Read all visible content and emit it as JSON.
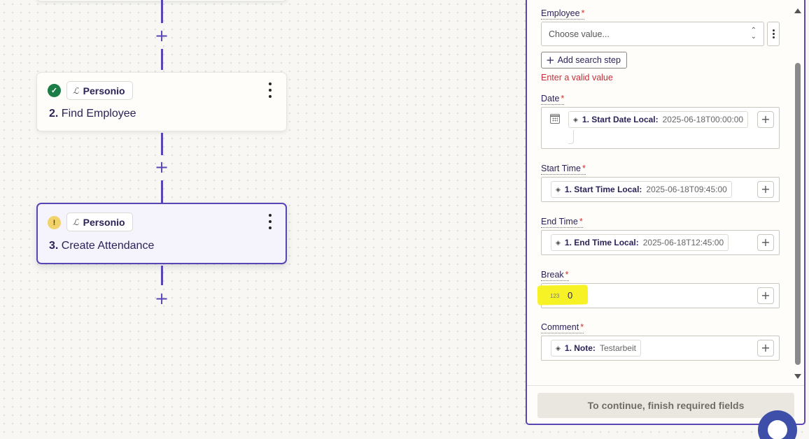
{
  "workflow": {
    "steps": [
      {
        "number": "2.",
        "title": "Find Employee",
        "app": "Personio",
        "status": "ok"
      },
      {
        "number": "3.",
        "title": "Create Attendance",
        "app": "Personio",
        "status": "warning"
      }
    ],
    "add_step_symbol": "+"
  },
  "panel": {
    "employee": {
      "label": "Employee",
      "required_mark": "*",
      "placeholder": "Choose value...",
      "add_search_step": "Add search step",
      "error": "Enter a valid value"
    },
    "date": {
      "label": "Date",
      "required_mark": "*",
      "pill_key": "1. Start Date Local:",
      "pill_value": "2025-06-18T00:00:00"
    },
    "start_time": {
      "label": "Start Time",
      "required_mark": "*",
      "pill_key": "1. Start Time Local:",
      "pill_value": "2025-06-18T09:45:00"
    },
    "end_time": {
      "label": "End Time",
      "required_mark": "*",
      "pill_key": "1. End Time Local:",
      "pill_value": "2025-06-18T12:45:00"
    },
    "break": {
      "label": "Break",
      "required_mark": "*",
      "type_badge": "123",
      "value": "0"
    },
    "comment": {
      "label": "Comment",
      "required_mark": "*",
      "pill_key": "1. Note:",
      "pill_value": "Testarbeit"
    },
    "continue_button": "To continue, finish required fields"
  },
  "colors": {
    "accent": "#5946b5",
    "success": "#1b7c45",
    "warning": "#f2d36b",
    "error": "#c0303a",
    "highlight": "#f7f226"
  },
  "icons": {
    "status_ok": "check-circle-icon",
    "status_warning": "exclamation-circle-icon",
    "app": "personio-logo-icon",
    "pill": "step-output-icon",
    "date": "calendar-icon"
  }
}
